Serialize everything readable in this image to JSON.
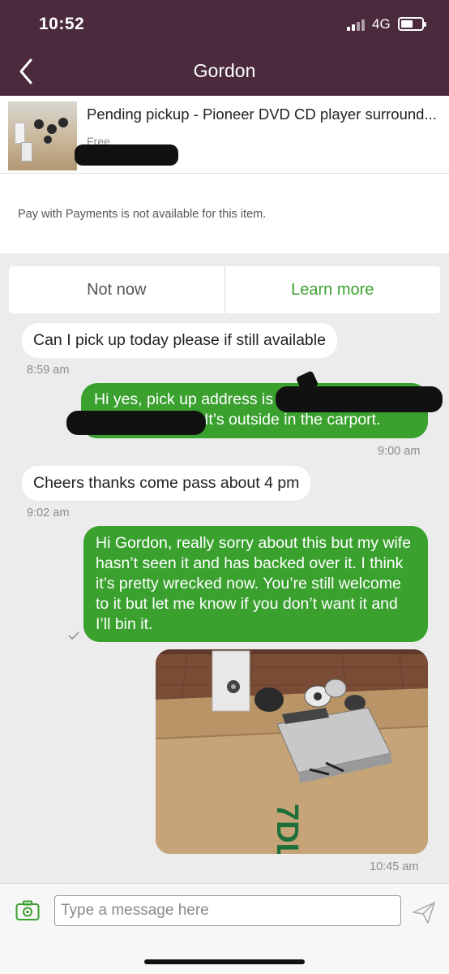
{
  "status_bar": {
    "time": "10:52",
    "network": "4G"
  },
  "header": {
    "title": "Gordon",
    "back_icon": "chevron-left-icon"
  },
  "listing": {
    "title": "Pending pickup - Pioneer DVD CD player surround...",
    "price": "Free"
  },
  "payments": {
    "notice": "Pay with Payments is not available for this item."
  },
  "actions": {
    "not_now": "Not now",
    "learn_more": "Learn more"
  },
  "messages": [
    {
      "direction": "incoming",
      "text": "Can I pick up today please if still available",
      "time": "8:59 am"
    },
    {
      "direction": "outgoing",
      "text_line1": "Hi yes, pick up address is",
      "text_line2": "It’s outside in the carport.",
      "time": "9:00 am"
    },
    {
      "direction": "incoming",
      "text": "Cheers thanks come pass about 4 pm",
      "time": "9:02 am"
    },
    {
      "direction": "outgoing",
      "text": "Hi Gordon, really sorry about this but my wife hasn’t seen it and has backed over it. I think it’s pretty wrecked now. You’re still welcome to it but let me know if you don’t want it and I’ll bin it."
    },
    {
      "direction": "outgoing",
      "type": "image",
      "time": "10:45 am"
    }
  ],
  "composer": {
    "placeholder": "Type a message here",
    "camera_icon": "camera-icon",
    "send_icon": "send-icon"
  },
  "colors": {
    "header": "#4a2a3c",
    "accent": "#3aa12f",
    "background": "#ececec"
  }
}
